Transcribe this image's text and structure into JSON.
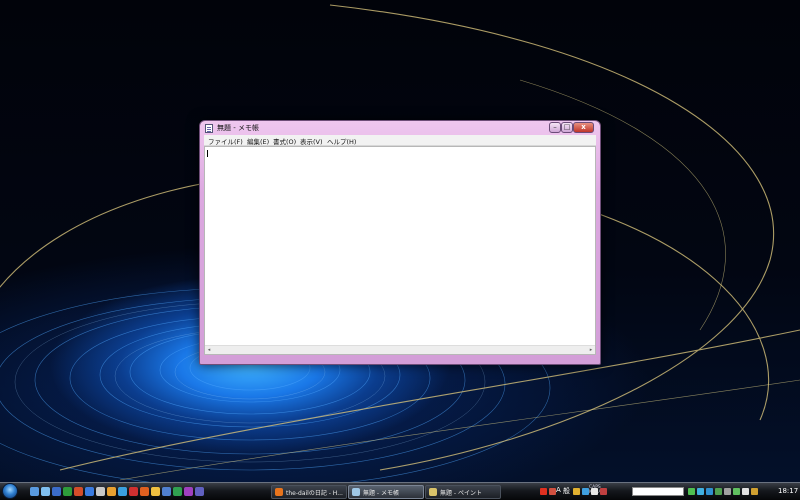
{
  "notepad": {
    "title": "無題 - メモ帳",
    "menu": [
      "ファイル(F)",
      "編集(E)",
      "書式(O)",
      "表示(V)",
      "ヘルプ(H)"
    ],
    "content": "",
    "min_glyph": "–",
    "max_glyph": "□",
    "close_glyph": "x",
    "scroll_left": "◂",
    "scroll_right": "▸"
  },
  "taskbar": {
    "windows": [
      {
        "label": "the-dailの日記 - H...",
        "active": false,
        "color": "#e8741c"
      },
      {
        "label": "無題 - メモ帳",
        "active": true,
        "color": "#9fc7e6"
      },
      {
        "label": "無題 - ペイント",
        "active": false,
        "color": "#d9c36a"
      }
    ],
    "quick_launch_colors": [
      "#5a9be0",
      "#7fbff0",
      "#3b6cc9",
      "#2e9c3a",
      "#d54d2a",
      "#3a7be0",
      "#c8c8c8",
      "#e8a030",
      "#3aa0e0",
      "#d03030",
      "#e06020",
      "#f0c040",
      "#5080d0",
      "#30a050",
      "#a040c0",
      "#6060c0"
    ],
    "tray_colors_left": [
      "#e03020",
      "#d05040"
    ],
    "ime_a": "A",
    "ime_kanji": "般",
    "tray_colors_mid": [
      "#e0b030",
      "#40a0e0",
      "#e8e8e8",
      "#c04040"
    ],
    "lang_lines": [
      "CAPS",
      "KANA"
    ],
    "tray_colors_right": [
      "#50c050",
      "#40b0e0",
      "#3090d0",
      "#50a050",
      "#a0a0a0",
      "#60c060",
      "#e0e0e0",
      "#d0a030"
    ],
    "clock": "18:17"
  }
}
